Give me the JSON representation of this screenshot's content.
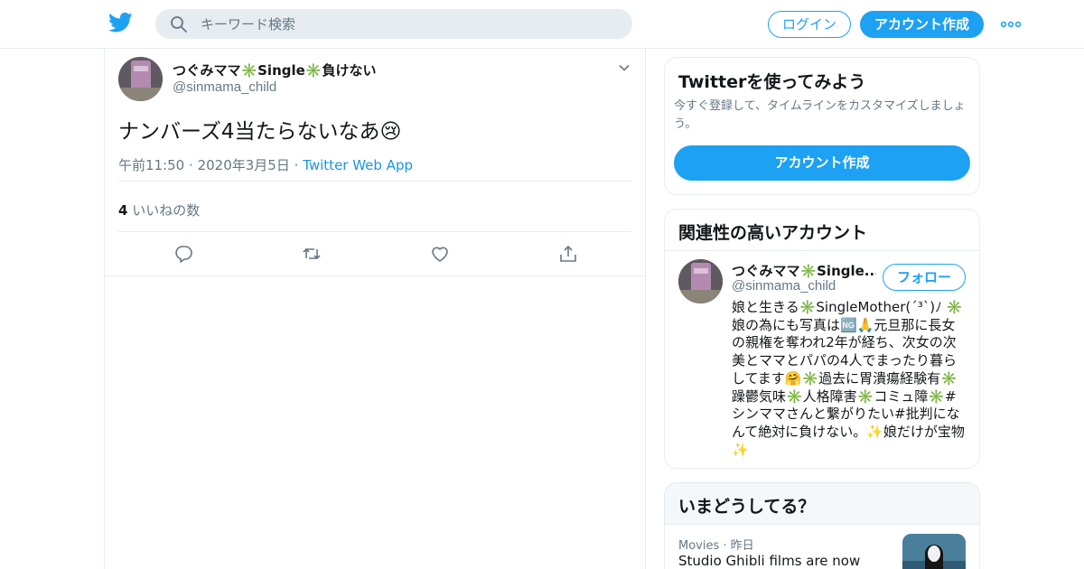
{
  "header": {
    "logo": "twitter-bird-icon",
    "search_placeholder": "キーワード検索",
    "login_label": "ログイン",
    "signup_label": "アカウント作成",
    "more_icon": "more-dots-icon",
    "brand_color": "#1da1f2"
  },
  "tweet": {
    "author_name": "つぐみママ✳️Single✳️負けない",
    "handle": "@sinmama_child",
    "text": "ナンバーズ4当たらないなあ😢",
    "time": "午前11:50",
    "dot1": "·",
    "date": "2020年3月5日",
    "dot2": "·",
    "source": "Twitter Web App",
    "likes_count": "4",
    "likes_label": "いいねの数",
    "actions": [
      "reply-icon",
      "retweet-icon",
      "like-icon",
      "share-icon"
    ]
  },
  "signup_card": {
    "title": "Twitterを使ってみよう",
    "description": "今すぐ登録して、タイムラインをカスタマイズしましょう。",
    "button_label": "アカウント作成"
  },
  "related_card": {
    "title": "関連性の高いアカウント",
    "name": "つぐみママ✳️Single...",
    "handle": "@sinmama_child",
    "follow_label": "フォロー",
    "bio": "娘と生きる✳️SingleMother(´³`)ﾉ ✳️娘の為にも写真は🆖🙏元旦那に長女の親権を奪われ2年が経ち、次女の次美とママとパパの4人でまったり暮らしてます🤗✳️過去に胃潰瘍経験有✳️躁鬱気味✳️人格障害✳️コミュ障✳️#シンママさんと繋がりたい#批判になんて絶対に負けない。✨娘だけが宝物✨"
  },
  "trends_card": {
    "title": "いまどうしてる？",
    "trend_category": "Movies",
    "trend_dot": "·",
    "trend_time": "昨日",
    "trend_title": "Studio Ghibli films are now"
  }
}
